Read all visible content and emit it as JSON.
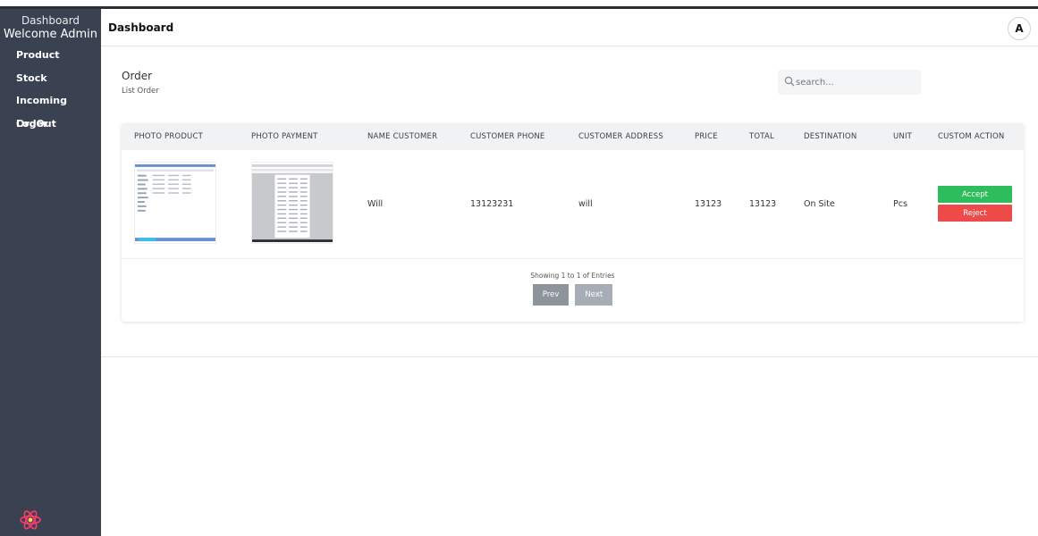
{
  "sidebar": {
    "title": "Dashboard",
    "welcome": "Welcome Admin",
    "items": [
      {
        "label": "Product"
      },
      {
        "label": "Stock"
      },
      {
        "label": "Incoming Order"
      },
      {
        "label": "LogOut"
      }
    ],
    "logo_icon": "react-logo-icon"
  },
  "header": {
    "title": "Dashboard",
    "avatar_letter": "A"
  },
  "page": {
    "title": "Order",
    "subtitle": "List Order",
    "search_placeholder": "search..."
  },
  "table": {
    "columns": [
      "PHOTO PRODUCT",
      "PHOTO PAYMENT",
      "NAME CUSTOMER",
      "CUSTOMER PHONE",
      "CUSTOMER ADDRESS",
      "PRICE",
      "TOTAL",
      "DESTINATION",
      "UNIT",
      "CUSTOM ACTION"
    ],
    "rows": [
      {
        "name_customer": "Will",
        "customer_phone": "13123231",
        "customer_address": "will",
        "price": "13123",
        "total": "13123",
        "destination": "On Site",
        "unit": "Pcs",
        "accept_label": "Accept",
        "reject_label": "Reject"
      }
    ]
  },
  "pagination": {
    "showing": "Showing 1 to 1 of Entries",
    "prev": "Prev",
    "next": "Next"
  },
  "colors": {
    "sidebar": "#3a4150",
    "accept": "#2dbd5c",
    "reject": "#ef4a4a"
  }
}
